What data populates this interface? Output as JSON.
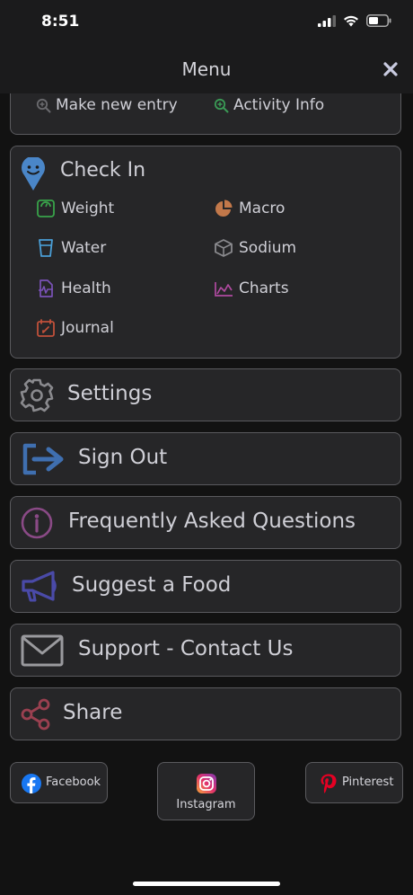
{
  "status": {
    "time": "8:51"
  },
  "nav": {
    "title": "Menu"
  },
  "top_card": {
    "items": [
      {
        "label": "Make new entry",
        "icon": "zoom-in-icon"
      },
      {
        "label": "Activity Info",
        "icon": "zoom-in-icon"
      }
    ]
  },
  "checkin": {
    "title": "Check In",
    "items": [
      {
        "label": "Weight",
        "icon": "scale-icon",
        "color": "#39a34a"
      },
      {
        "label": "Macro",
        "icon": "pie-chart-icon",
        "color": "#c2784a"
      },
      {
        "label": "Water",
        "icon": "glass-icon",
        "color": "#4a9ed6"
      },
      {
        "label": "Sodium",
        "icon": "cube-icon",
        "color": "#8a8a8e"
      },
      {
        "label": "Health",
        "icon": "health-file-icon",
        "color": "#7a52b8"
      },
      {
        "label": "Charts",
        "icon": "area-chart-icon",
        "color": "#b04aa0"
      },
      {
        "label": "Journal",
        "icon": "calendar-edit-icon",
        "color": "#c0503a"
      }
    ]
  },
  "menu": {
    "settings": "Settings",
    "sign_out": "Sign Out",
    "faq": "Frequently Asked Questions",
    "suggest": "Suggest a Food",
    "support": "Support - Contact Us",
    "share": "Share"
  },
  "social": {
    "facebook": "Facebook",
    "instagram": "Instagram",
    "pinterest": "Pinterest"
  },
  "colors": {
    "background": "#121212",
    "card": "#262628",
    "border": "#5a5a5e",
    "checkin_pin": "#4a86c8",
    "signout": "#3f6fb0",
    "faq": "#8a4a86",
    "suggest": "#4a4aa8",
    "share": "#9a4050"
  }
}
